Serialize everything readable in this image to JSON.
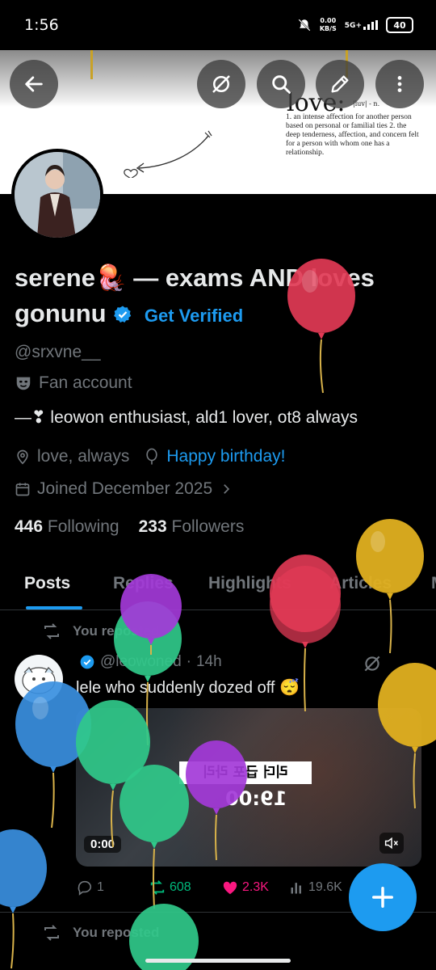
{
  "status_bar": {
    "time": "1:56",
    "net_speed_top": "0.00",
    "net_speed_unit": "KB/S",
    "network": "5G+",
    "battery": "40"
  },
  "banner": {
    "love_word": "love:",
    "love_pron": "|luv| - n.",
    "love_definition": "1. an intense affection for another person based on personal or familial ties 2. the deep tenderness, affection, and concern felt for a person with whom one has a relationship."
  },
  "profile": {
    "name_part1": "serene",
    "name_emoji": "🪼",
    "name_part2": "— exams AND loves gonunu",
    "verify_label": "Get Verified",
    "handle": "@srxvne__",
    "category": "Fan account",
    "bio": "—❣ leowon enthusiast, ald1 lover, ot8 always",
    "location": "love, always",
    "birthday_link": "Happy birthday!",
    "joined": "Joined December 2025",
    "following_count": "446",
    "following_label": "Following",
    "followers_count": "233",
    "followers_label": "Followers"
  },
  "tabs": [
    {
      "label": "Posts",
      "active": true
    },
    {
      "label": "Replies"
    },
    {
      "label": "Highlights"
    },
    {
      "label": "Articles"
    },
    {
      "label": "M"
    }
  ],
  "repost_label": "You reposted",
  "tweet": {
    "handle": "@leowoned",
    "time": "14h",
    "text": "lele who suddenly dozed off 😴",
    "video_caption": "리더 급포 라리",
    "video_clock": "19:00",
    "video_time": "0:00",
    "replies": "1",
    "reposts": "608",
    "likes": "2.3K",
    "views": "19.6K"
  },
  "second_repost_label": "You reposted",
  "colors": {
    "accent": "#1d9bf0",
    "like": "#f91880",
    "repost": "#00ba7c",
    "bg": "#000000"
  }
}
